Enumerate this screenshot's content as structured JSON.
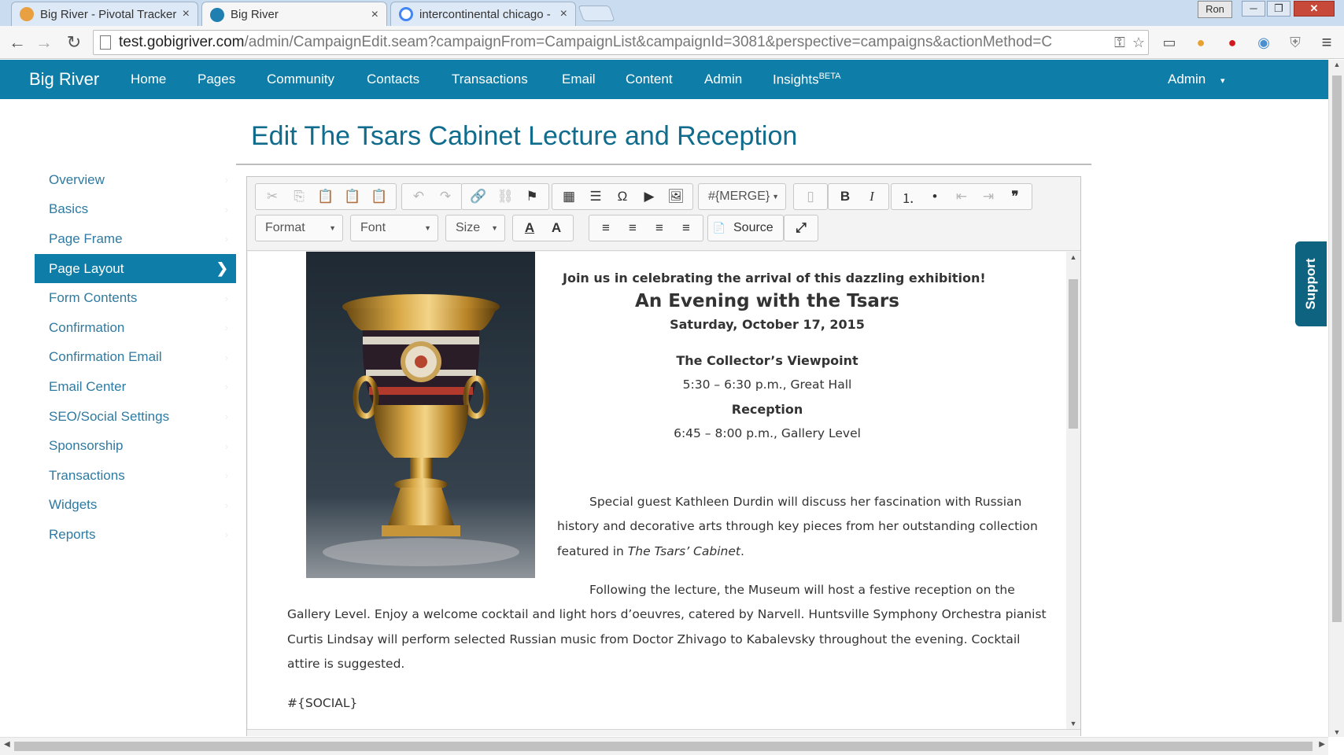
{
  "browser": {
    "tabs": [
      {
        "title": "Big River - Pivotal Tracker",
        "close": "×"
      },
      {
        "title": "Big River",
        "close": "×"
      },
      {
        "title": "intercontinental chicago -",
        "close": "×"
      }
    ],
    "user_label": "Ron",
    "window_buttons": {
      "min": "─",
      "max": "❐",
      "close": "✕"
    },
    "url_host": "test.gobigriver.com",
    "url_path": "/admin/CampaignEdit.seam?campaignFrom=CampaignList&campaignId=3081&perspective=campaigns&actionMethod=C",
    "nav": {
      "back": "←",
      "forward": "→",
      "reload": "↻"
    },
    "omnibox_icons": {
      "key": "⚿",
      "star": "☆"
    },
    "extensions": {
      "cast": "▭",
      "color": "●",
      "shield": "●",
      "camera": "◉",
      "ghost": "⛨",
      "menu": "≡"
    }
  },
  "app_nav": {
    "brand": "Big River",
    "items": [
      "Home",
      "Pages",
      "Community",
      "Contacts",
      "Transactions",
      "Email",
      "Content",
      "Admin",
      "Insights"
    ],
    "insights_badge": "BETA",
    "user_menu": "Admin",
    "caret": "▾"
  },
  "page": {
    "title": "Edit The Tsars Cabinet Lecture and Reception"
  },
  "sidebar": {
    "chevron": "›",
    "active_chevron": "❯",
    "items": [
      {
        "label": "Overview"
      },
      {
        "label": "Basics"
      },
      {
        "label": "Page Frame"
      },
      {
        "label": "Page Layout"
      },
      {
        "label": "Form Contents"
      },
      {
        "label": "Confirmation"
      },
      {
        "label": "Confirmation Email"
      },
      {
        "label": "Email Center"
      },
      {
        "label": "SEO/Social Settings"
      },
      {
        "label": "Sponsorship"
      },
      {
        "label": "Transactions"
      },
      {
        "label": "Widgets"
      },
      {
        "label": "Reports"
      }
    ],
    "active_index": 3
  },
  "editor": {
    "toolbar": {
      "merge_label": "#{MERGE}",
      "format_label": "Format",
      "font_label": "Font",
      "size_label": "Size",
      "source_label": "Source",
      "icons": {
        "cut": "✂",
        "copy": "⎘",
        "paste": "📋",
        "paste_text": "📋",
        "paste_word": "📋",
        "undo": "↶",
        "redo": "↷",
        "link": "🔗",
        "unlink": "⛓",
        "anchor": "⚑",
        "table": "▦",
        "hr": "☰",
        "omega": "Ω",
        "youtube": "▶",
        "image": "🖼",
        "doc": "▯",
        "bold": "B",
        "italic": "I",
        "ol": "⒈",
        "ul": "•",
        "outdent": "⇤",
        "indent": "⇥",
        "quote": "❞",
        "text_color": "A",
        "bg_color": "A",
        "align_left": "≡",
        "align_center": "≡",
        "align_right": "≡",
        "justify": "≡",
        "maximize": "⤢",
        "dropdown": "▼",
        "source": "📄"
      }
    },
    "content": {
      "join": "Join us in celebrating the arrival of this dazzling exhibition!",
      "evening": "An Evening with the Tsars",
      "date": "Saturday, October 17, 2015",
      "collector": "The Collector’s Viewpoint",
      "time1": "5:30 – 6:30 p.m., Great Hall",
      "reception": "Reception",
      "time2": "6:45 – 8:00 p.m., Gallery Level",
      "para1_a": "Special guest Kathleen Durdin will discuss her fascination with Russian history and decorative arts through key pieces from her outstanding collection featured in ",
      "para1_em": "The Tsars’ Cabinet",
      "para1_b": ".",
      "para2": "Following the lecture, the Museum will host a festive reception on the Gallery Level. Enjoy a welcome cocktail and light hors d’oeuvres, catered by Narvell. Huntsville Symphony Orchestra pianist Curtis Lindsay will perform selected Russian music from Doctor Zhivago to Kabalevsky throughout the evening. Cocktail attire is suggested.",
      "social": "#{SOCIAL}"
    }
  },
  "support_label": "Support",
  "scroll_arrows": {
    "up": "▲",
    "down": "▼",
    "left": "◀",
    "right": "▶"
  },
  "colors": {
    "brand_bar": "#0e7ea8",
    "link": "#2f7aa1",
    "title": "#106c8c"
  }
}
